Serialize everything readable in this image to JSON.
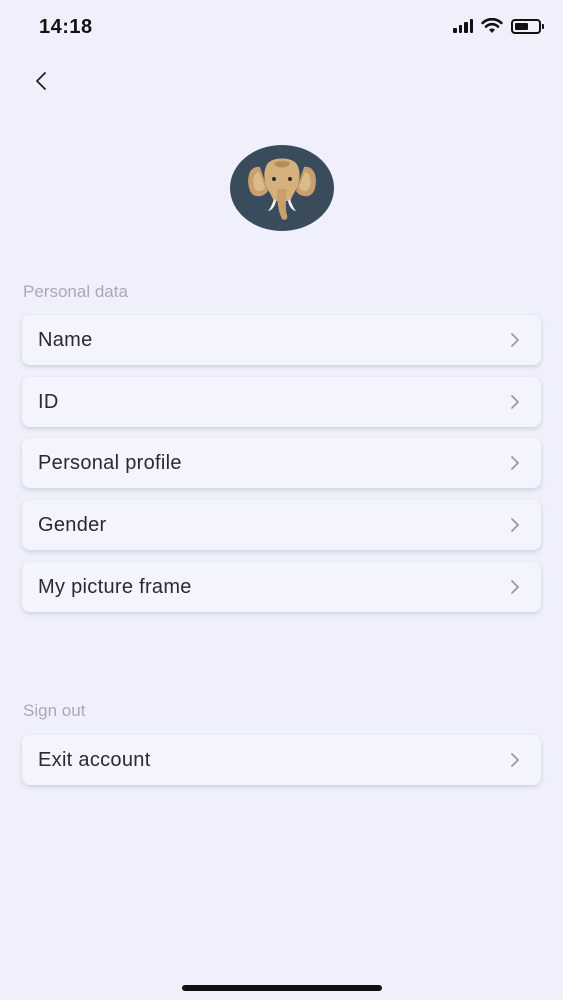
{
  "status_bar": {
    "time": "14:18",
    "icons": [
      "signal-icon",
      "wifi-icon",
      "battery-icon"
    ]
  },
  "header": {
    "back_icon": "chevron-left-icon"
  },
  "profile": {
    "avatar_icon": "elephant-avatar"
  },
  "sections": {
    "personal": {
      "title": "Personal data",
      "items": [
        {
          "label": "Name"
        },
        {
          "label": "ID"
        },
        {
          "label": "Personal profile"
        },
        {
          "label": "Gender"
        },
        {
          "label": "My picture frame"
        }
      ]
    },
    "signout": {
      "title": "Sign out",
      "items": [
        {
          "label": "Exit account"
        }
      ]
    }
  },
  "colors": {
    "background": "#eff0fb",
    "card": "#f3f4fc",
    "section_label": "#a9aab3",
    "chevron": "#9a9aa3",
    "avatar_bg": "#3a4b5c"
  }
}
